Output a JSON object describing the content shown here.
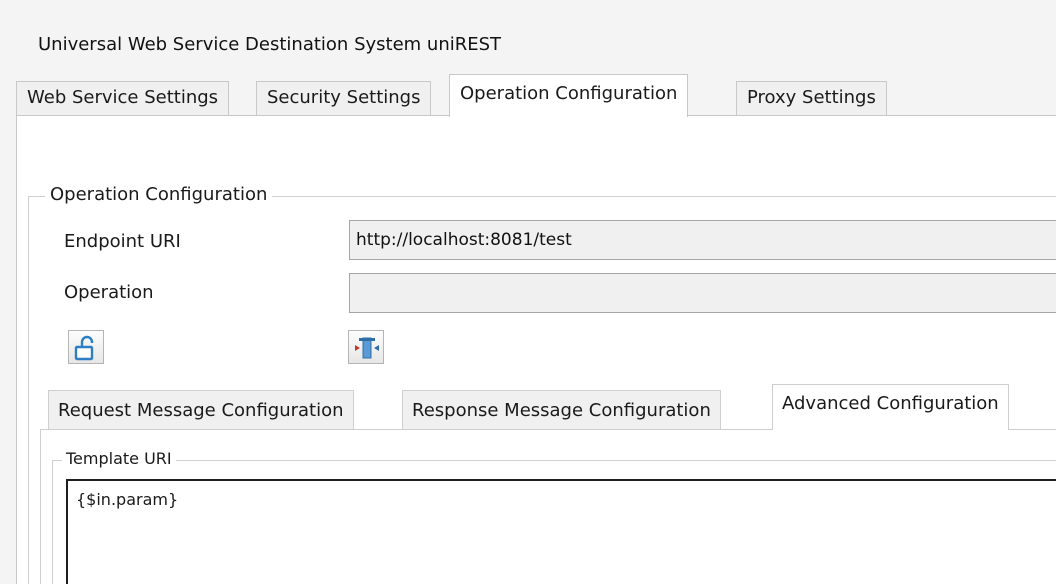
{
  "window": {
    "title": "Universal Web Service Destination System uniREST"
  },
  "outer_tabs": [
    {
      "label": "Web Service Settings",
      "active": false
    },
    {
      "label": "Security Settings",
      "active": false
    },
    {
      "label": "Operation Configuration",
      "active": true
    },
    {
      "label": "Proxy Settings",
      "active": false
    }
  ],
  "operation_group": {
    "legend": "Operation Configuration",
    "endpoint": {
      "label": "Endpoint URI",
      "value": "http://localhost:8081/test"
    },
    "operation": {
      "label": "Operation",
      "value": ""
    },
    "buttons": [
      {
        "icon": "unlock-icon"
      },
      {
        "icon": "operation-mapping-icon"
      }
    ]
  },
  "inner_tabs": [
    {
      "label": "Request Message Configuration",
      "active": false
    },
    {
      "label": "Response Message Configuration",
      "active": false
    },
    {
      "label": "Advanced Configuration",
      "active": true
    }
  ],
  "advanced": {
    "legend": "Template URI",
    "template_value": "{$in.param}"
  },
  "colors": {
    "panel_bg": "#ffffff",
    "window_bg": "#f4f4f4",
    "tab_inactive": "#f0f0f0",
    "field_bg": "#f0f0f0",
    "icon_blue": "#2e7fc1",
    "icon_red": "#c0392b"
  }
}
